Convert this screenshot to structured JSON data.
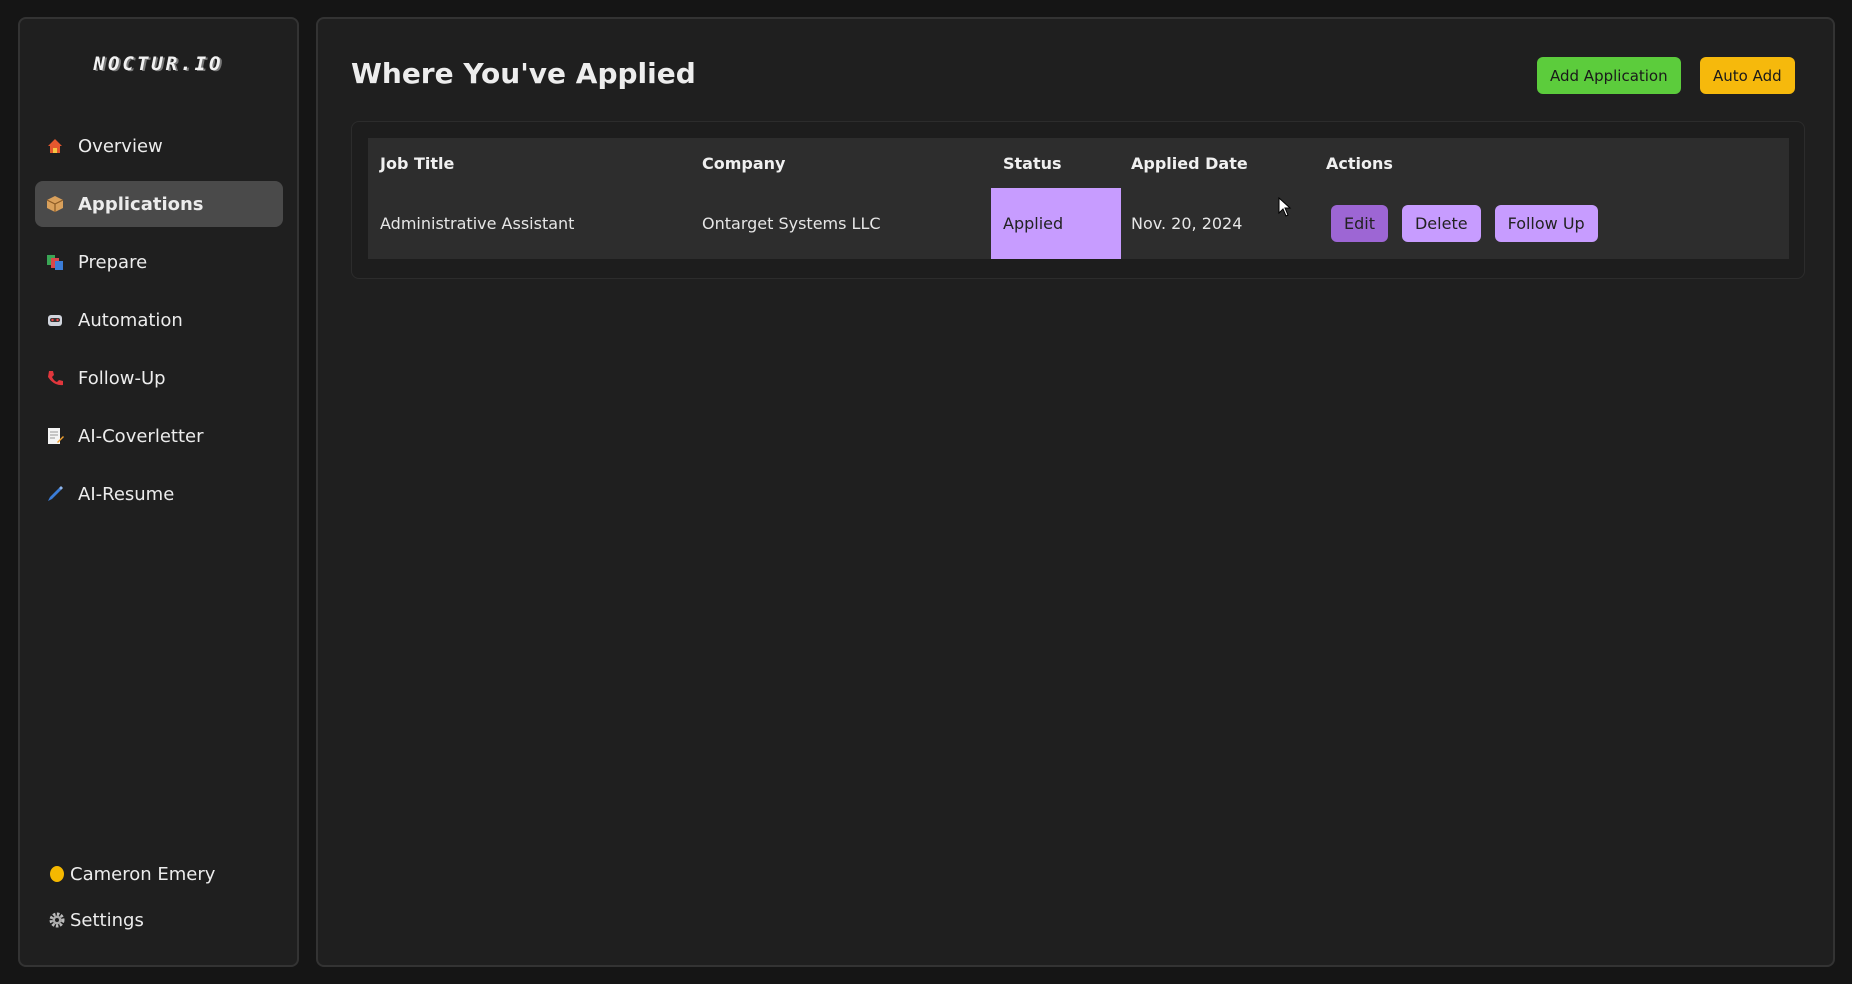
{
  "sidebar": {
    "logo": "NOCTUR.IO",
    "items": [
      {
        "label": "Overview",
        "icon": "house-icon"
      },
      {
        "label": "Applications",
        "icon": "package-icon"
      },
      {
        "label": "Prepare",
        "icon": "books-icon"
      },
      {
        "label": "Automation",
        "icon": "robot-icon"
      },
      {
        "label": "Follow-Up",
        "icon": "phone-icon"
      },
      {
        "label": "AI-Coverletter",
        "icon": "memo-icon"
      },
      {
        "label": "AI-Resume",
        "icon": "pen-icon"
      }
    ],
    "active_item": "Applications",
    "user_name": "Cameron Emery",
    "settings_label": "Settings"
  },
  "header": {
    "title": "Where You've Applied",
    "add_label": "Add Application",
    "auto_label": "Auto Add"
  },
  "table": {
    "columns": [
      "Job Title",
      "Company",
      "Status",
      "Applied Date",
      "Actions"
    ],
    "rows": [
      {
        "job_title": "Administrative Assistant",
        "company": "Ontarget Systems LLC",
        "status": "Applied",
        "applied_date": "Nov. 20, 2024",
        "actions": [
          "Edit",
          "Delete",
          "Follow Up"
        ]
      }
    ]
  },
  "colors": {
    "add_button": "#5ccc3c",
    "auto_button": "#f6b90c",
    "status_applied": "#c79cff",
    "edit_button": "#9d66d4"
  }
}
